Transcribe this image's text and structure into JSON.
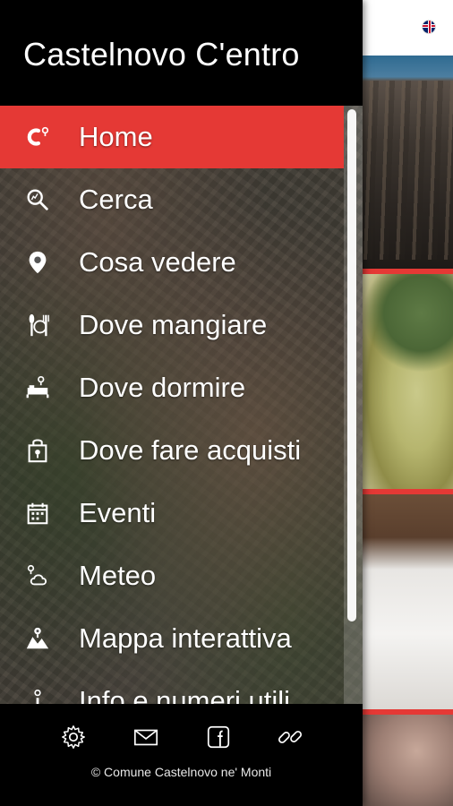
{
  "app": {
    "title": "Castelnovo C'entro"
  },
  "menu": {
    "items": [
      {
        "label": "Home",
        "icon": "castelnovo-logo-icon",
        "active": true
      },
      {
        "label": "Cerca",
        "icon": "search-icon",
        "active": false
      },
      {
        "label": "Cosa vedere",
        "icon": "location-pin-icon",
        "active": false
      },
      {
        "label": "Dove mangiare",
        "icon": "restaurant-icon",
        "active": false
      },
      {
        "label": "Dove dormire",
        "icon": "bed-icon",
        "active": false
      },
      {
        "label": "Dove fare acquisti",
        "icon": "shopping-bag-icon",
        "active": false
      },
      {
        "label": "Eventi",
        "icon": "calendar-icon",
        "active": false
      },
      {
        "label": "Meteo",
        "icon": "weather-icon",
        "active": false
      },
      {
        "label": "Mappa interattiva",
        "icon": "map-icon",
        "active": false
      },
      {
        "label": "Info e numeri utili",
        "icon": "info-icon",
        "active": false
      }
    ]
  },
  "footer": {
    "icons": [
      "settings-icon",
      "mail-icon",
      "facebook-icon",
      "link-icon"
    ],
    "copyright": "© Comune Castelnovo ne' Monti"
  },
  "colors": {
    "accent": "#e53935",
    "drawer_bg": "#000000",
    "text": "#ffffff"
  }
}
